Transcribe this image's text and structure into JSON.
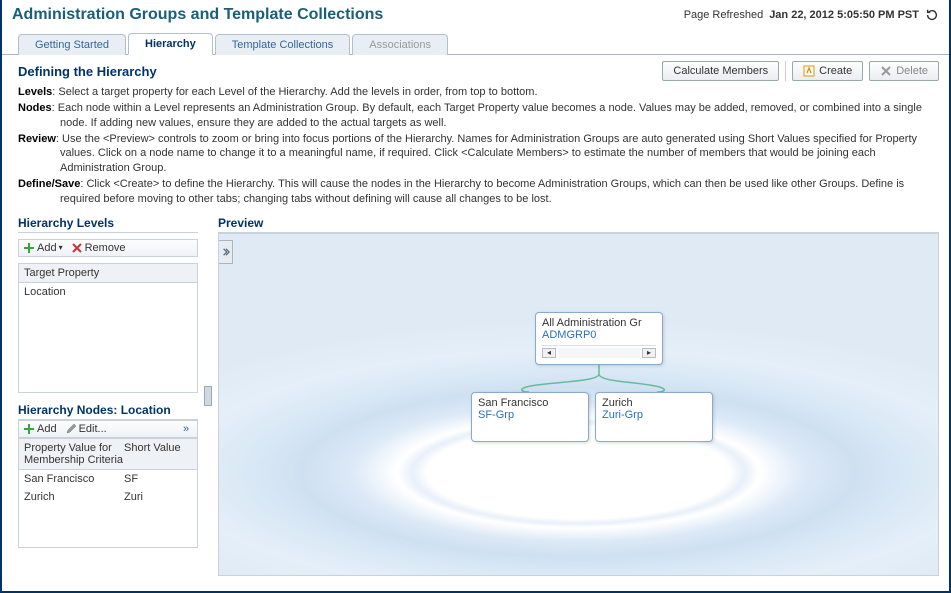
{
  "header": {
    "title": "Administration Groups and Template Collections",
    "refreshed_prefix": "Page Refreshed",
    "refreshed_value": "Jan 22, 2012 5:05:50 PM PST"
  },
  "tabs": [
    {
      "label": "Getting Started"
    },
    {
      "label": "Hierarchy"
    },
    {
      "label": "Template Collections"
    },
    {
      "label": "Associations"
    }
  ],
  "subheader": {
    "title": "Defining the Hierarchy"
  },
  "actions": {
    "calc": "Calculate Members",
    "create": "Create",
    "delete": "Delete"
  },
  "desc": {
    "levels_key": "Levels",
    "levels_text": ": Select a target property for each Level of the Hierarchy. Add the levels in order, from top to bottom.",
    "nodes_key": "Nodes",
    "nodes_text": ": Each node within a Level represents an Administration Group. By default, each Target Property value becomes a node. Values may be added, removed, or combined into a single node. If adding new values, ensure they are added to the actual targets as well.",
    "review_key": "Review",
    "review_text": ": Use the <Preview> controls to zoom or bring into focus portions of the Hierarchy. Names for Administration Groups are auto generated using Short Values specified for Property values. Click on a node name to change it to a meaningful name, if required. Click <Calculate Members> to estimate the number of members that would be joining each Administration Group.",
    "define_key": "Define/Save",
    "define_text": ": Click <Create> to define the Hierarchy. This will cause the nodes in the Hierarchy to become Administration Groups, which can then be used like other Groups. Define is required before moving to other tabs; changing tabs without defining will cause all changes to be lost."
  },
  "levels_panel": {
    "title": "Hierarchy Levels",
    "add": "Add",
    "remove": "Remove",
    "col": "Target Property",
    "rows": [
      "Location"
    ]
  },
  "nodes_panel": {
    "title": "Hierarchy Nodes: Location",
    "add": "Add",
    "edit": "Edit...",
    "col_a": "Property Value for Membership Criteria",
    "col_b": "Short Value",
    "rows": [
      {
        "a": "San Francisco",
        "b": "SF"
      },
      {
        "a": "Zurich",
        "b": "Zuri"
      }
    ]
  },
  "preview": {
    "title": "Preview",
    "root_title": "All Administration Gr",
    "root_group": "ADMGRP0",
    "child1_title": "San Francisco",
    "child1_group": "SF-Grp",
    "child2_title": "Zurich",
    "child2_group": "Zuri-Grp"
  }
}
